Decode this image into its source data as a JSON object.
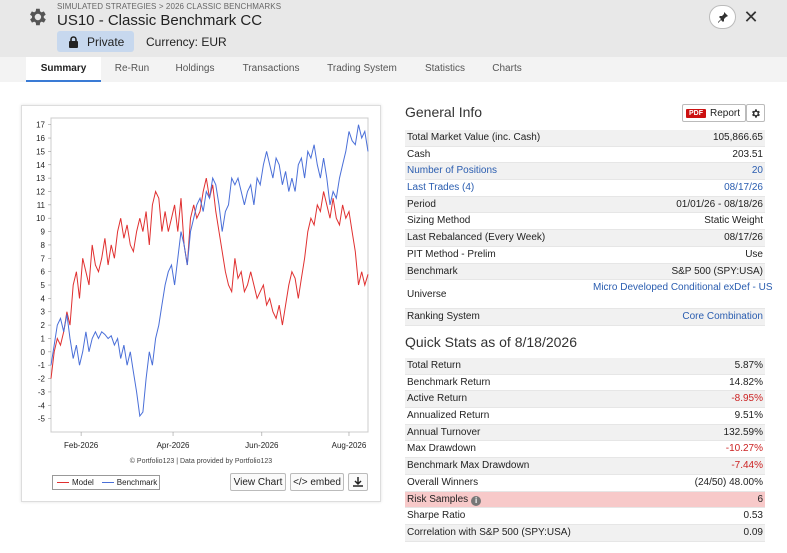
{
  "header": {
    "breadcrumb": "SIMULATED STRATEGIES > 2026 CLASSIC BENCHMARKS",
    "title": "US10 - Classic Benchmark CC",
    "privacy_label": "Private",
    "currency_label": "Currency: EUR",
    "close_symbol": "✕"
  },
  "tabs": [
    {
      "label": "Summary",
      "active": true
    },
    {
      "label": "Re-Run"
    },
    {
      "label": "Holdings"
    },
    {
      "label": "Transactions"
    },
    {
      "label": "Trading System"
    },
    {
      "label": "Statistics"
    },
    {
      "label": "Charts"
    }
  ],
  "chart_panel": {
    "credit": "© Portfolio123 | Data provided by Portfolio123",
    "legend": [
      "Model",
      "Benchmark"
    ],
    "view_chart_label": "View Chart",
    "embed_label": "</> embed"
  },
  "chart_data": {
    "type": "line",
    "x_tick_labels": [
      "Feb-2026",
      "Apr-2026",
      "Jun-2026",
      "Aug-2026"
    ],
    "y_ticks": [
      -5,
      -4,
      -3,
      -2,
      -1,
      0,
      1,
      2,
      3,
      4,
      5,
      6,
      7,
      8,
      9,
      10,
      11,
      12,
      13,
      14,
      15,
      16,
      17
    ],
    "ylim": [
      -6,
      17.5
    ],
    "series": [
      {
        "name": "Model",
        "color": "#e03030",
        "x": [
          0,
          1,
          2,
          3,
          4,
          5,
          6,
          7,
          8,
          9,
          10,
          11,
          12,
          13,
          14,
          15,
          16,
          17,
          18,
          19,
          20,
          21,
          22,
          23,
          24,
          25,
          26,
          27,
          28,
          29,
          30,
          31,
          32,
          33,
          34,
          35,
          36,
          37,
          38,
          39,
          40,
          41,
          42,
          43,
          44,
          45,
          46,
          47,
          48,
          49,
          50,
          51,
          52,
          53,
          54,
          55,
          56,
          57,
          58,
          59,
          60,
          61,
          62,
          63,
          64,
          65,
          66,
          67,
          68,
          69,
          70,
          71,
          72,
          73,
          74,
          75,
          76,
          77,
          78,
          79,
          80,
          81,
          82,
          83,
          84,
          85,
          86,
          87,
          88,
          89,
          90,
          91,
          92,
          93,
          94,
          95,
          96,
          97,
          98,
          99,
          100
        ],
        "values": [
          -2,
          0,
          1,
          0.5,
          1.5,
          3,
          2,
          5,
          6,
          4,
          7,
          6,
          5,
          8,
          6.5,
          6,
          7,
          8.5,
          6.5,
          8,
          7,
          9,
          10,
          8.5,
          9.5,
          8,
          7.5,
          9,
          10,
          9,
          10.5,
          8,
          11,
          12,
          11.5,
          9,
          10.5,
          9,
          10,
          11,
          9,
          11.5,
          8,
          6.5,
          10,
          11,
          10,
          10.5,
          12,
          13,
          11.5,
          12.5,
          10.5,
          9,
          7.5,
          6,
          5,
          4.5,
          7,
          5.5,
          6,
          4.5,
          5,
          6,
          5,
          4,
          4.5,
          5,
          3.5,
          4,
          3,
          2.5,
          3.5,
          2,
          3.5,
          5,
          6,
          5.5,
          4,
          5.5,
          7,
          9,
          10,
          9.5,
          11,
          10.5,
          12,
          11,
          10,
          11.5,
          10,
          9.5,
          11,
          10,
          10.5,
          9,
          7.5,
          5,
          6,
          5,
          5.8
        ]
      },
      {
        "name": "Benchmark",
        "color": "#4a6fd8",
        "x": [
          0,
          1,
          2,
          3,
          4,
          5,
          6,
          7,
          8,
          9,
          10,
          11,
          12,
          13,
          14,
          15,
          16,
          17,
          18,
          19,
          20,
          21,
          22,
          23,
          24,
          25,
          26,
          27,
          28,
          29,
          30,
          31,
          32,
          33,
          34,
          35,
          36,
          37,
          38,
          39,
          40,
          41,
          42,
          43,
          44,
          45,
          46,
          47,
          48,
          49,
          50,
          51,
          52,
          53,
          54,
          55,
          56,
          57,
          58,
          59,
          60,
          61,
          62,
          63,
          64,
          65,
          66,
          67,
          68,
          69,
          70,
          71,
          72,
          73,
          74,
          75,
          76,
          77,
          78,
          79,
          80,
          81,
          82,
          83,
          84,
          85,
          86,
          87,
          88,
          89,
          90,
          91,
          92,
          93,
          94,
          95,
          96,
          97,
          98,
          99,
          100
        ],
        "values": [
          -1,
          0.5,
          2,
          2.5,
          1.5,
          2.8,
          1,
          -0.5,
          0.5,
          -1,
          0,
          1.5,
          0,
          1,
          1.5,
          1,
          1.5,
          1.3,
          1,
          1.2,
          0.5,
          1,
          -0.5,
          0.5,
          -1,
          0,
          -1.5,
          -3,
          -4.8,
          -4.5,
          -2,
          0,
          -1,
          1,
          2,
          3.5,
          5,
          6,
          6.5,
          5,
          7,
          9,
          8,
          6.5,
          9,
          10,
          11,
          11.5,
          10.5,
          12,
          11.5,
          13,
          12.5,
          11,
          9,
          10.5,
          11,
          13,
          12.5,
          13,
          12,
          11,
          12,
          12.5,
          11,
          13,
          12.5,
          14,
          15,
          14,
          13,
          14.5,
          14,
          12.5,
          13.5,
          12,
          13,
          12,
          14,
          14.5,
          13,
          15,
          14.5,
          15.5,
          14,
          13,
          14.5,
          13,
          11,
          12,
          11.5,
          13,
          14,
          15,
          16.5,
          15.8,
          15.5,
          17,
          16,
          16.5,
          15
        ]
      }
    ]
  },
  "general_info": {
    "title": "General Info",
    "pdf_tag": "PDF",
    "report_label": "Report",
    "rows": [
      {
        "label": "Total Market Value (inc. Cash)",
        "value": "105,866.65"
      },
      {
        "label": "Cash",
        "value": "203.51"
      },
      {
        "label": "Number of Positions",
        "value": "20"
      },
      {
        "label": "Last Trades (4)",
        "value": "08/17/26"
      },
      {
        "label": "Period",
        "value": "01/01/26 - 08/18/26"
      },
      {
        "label": "Sizing Method",
        "value": "Static Weight"
      },
      {
        "label": "Last Rebalanced (Every Week)",
        "value": "08/17/26"
      },
      {
        "label": "PIT Method - Prelim",
        "value": "Use"
      },
      {
        "label": "Benchmark",
        "value": "S&P 500 (SPY:USA)"
      },
      {
        "label": "Universe",
        "value": "Micro Developed Conditional exDef - US"
      },
      {
        "label": "Ranking System",
        "value": "Core Combination"
      }
    ]
  },
  "quick_stats": {
    "title": "Quick Stats as of 8/18/2026",
    "rows": [
      {
        "label": "Total Return",
        "value": "5.87%"
      },
      {
        "label": "Benchmark Return",
        "value": "14.82%"
      },
      {
        "label": "Active Return",
        "value": "-8.95%"
      },
      {
        "label": "Annualized Return",
        "value": "9.51%"
      },
      {
        "label": "Annual Turnover",
        "value": "132.59%"
      },
      {
        "label": "Max Drawdown",
        "value": "-10.27%"
      },
      {
        "label": "Benchmark Max Drawdown",
        "value": "-7.44%"
      },
      {
        "label": "Overall Winners",
        "value": "(24/50) 48.00%"
      },
      {
        "label": "Risk Samples",
        "value": "6",
        "info_icon": "i"
      },
      {
        "label": "Sharpe Ratio",
        "value": "0.53"
      },
      {
        "label": "Correlation with S&P 500 (SPY:USA)",
        "value": "0.09"
      }
    ]
  }
}
